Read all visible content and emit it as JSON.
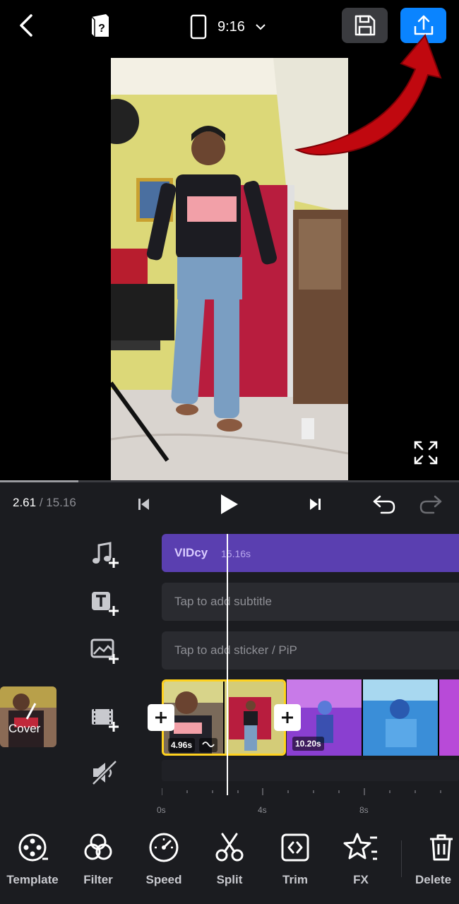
{
  "topbar": {
    "ratio_label": "9:16",
    "accent": "#0a84ff"
  },
  "timeline": {
    "current_time": "2.61",
    "separator": " / ",
    "total_time": "15.16",
    "progress": 0.17
  },
  "tracks": {
    "music_name": "VIDcy",
    "music_duration": "15.16s",
    "subtitle_placeholder": "Tap to add subtitle",
    "sticker_placeholder": "Tap to add sticker / PiP",
    "cover_label": "Cover"
  },
  "clips": [
    {
      "duration": "4.96s"
    },
    {
      "duration": "10.20s"
    }
  ],
  "ruler": {
    "labels": [
      "0s",
      "4s",
      "8s"
    ]
  },
  "toolbar": {
    "items": [
      {
        "label": "Template",
        "icon": "template-icon"
      },
      {
        "label": "Filter",
        "icon": "filter-icon"
      },
      {
        "label": "Speed",
        "icon": "speed-icon"
      },
      {
        "label": "Split",
        "icon": "scissors-icon"
      },
      {
        "label": "Trim",
        "icon": "trim-icon"
      },
      {
        "label": "FX",
        "icon": "fx-star-icon"
      },
      {
        "label": "Delete",
        "icon": "trash-icon"
      }
    ]
  }
}
